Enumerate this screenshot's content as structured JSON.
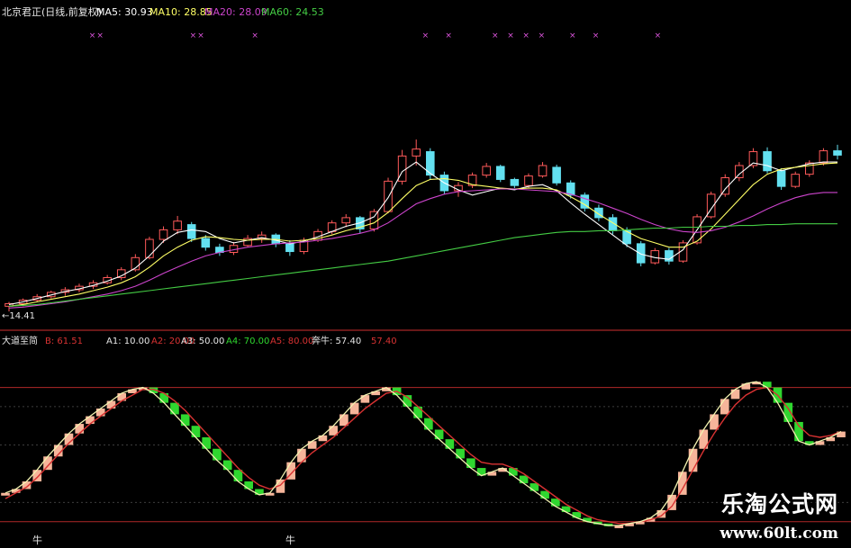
{
  "header": {
    "name": "北京君正(日线,前复权)",
    "ma5": "MA5: 30.93",
    "ma10": "MA10: 28.85",
    "ma20": "MA20: 28.09",
    "ma60": "MA60: 24.53"
  },
  "low_label": "←14.41",
  "indicator_header": {
    "name": "大道至简",
    "b": "B: 61.51",
    "a1": "A1: 10.00",
    "a2": "A2: 20.00",
    "a3": "A3: 50.00",
    "a4": "A4: 70.00",
    "a5": "A5: 80.00",
    "bull": "奔牛: 57.40",
    "last": "57.40"
  },
  "bull_markers": [
    "牛",
    "牛"
  ],
  "watermark": {
    "title": "乐淘公式网",
    "url": "www.60lt.com"
  },
  "colors": {
    "background": "#000000",
    "up_candle": "#ff5a5a",
    "down_candle": "#63e0f0",
    "ma5": "#ffffff",
    "ma10": "#ffff66",
    "ma20": "#cc44cc",
    "ma60": "#44cc44",
    "rising_bar": "#f6b59a",
    "falling_bar": "#2fd72f",
    "a_line": "#f2f2b0",
    "b_line": "#d83232",
    "level_line": "#b02828",
    "marker": "#dd55dd"
  },
  "chart_data": [
    {
      "type": "candlestick",
      "title": "北京君正(日线,前复权)",
      "ylim": [
        14,
        37
      ],
      "low_marker": 14.41,
      "series": [
        {
          "name": "MA5",
          "values": [
            15.2,
            15.5,
            15.9,
            16.3,
            16.7,
            17.0,
            17.4,
            17.9,
            18.5,
            19.4,
            20.8,
            22.5,
            23.5,
            23.8,
            23.6,
            22.8,
            22.3,
            22.6,
            22.9,
            22.6,
            22.2,
            22.5,
            23.0,
            23.6,
            24.2,
            24.6,
            25.3,
            27.5,
            30.5,
            31.6,
            30.3,
            29.2,
            28.4,
            27.8,
            28.2,
            28.6,
            28.4,
            28.8,
            29.0,
            28.3,
            26.9,
            25.6,
            24.4,
            23.2,
            22.0,
            21.0,
            20.6,
            20.4,
            21.5,
            23.8,
            26.2,
            28.5,
            30.2,
            31.5,
            31.2,
            30.6,
            31.0,
            31.4,
            31.6,
            31.6
          ]
        },
        {
          "name": "MA10",
          "values": [
            15.0,
            15.2,
            15.5,
            15.8,
            16.1,
            16.4,
            16.8,
            17.2,
            17.7,
            18.4,
            19.5,
            20.8,
            21.8,
            22.6,
            23.0,
            22.9,
            22.7,
            22.6,
            22.7,
            22.7,
            22.5,
            22.6,
            22.8,
            23.2,
            23.7,
            24.1,
            24.6,
            25.8,
            27.4,
            28.9,
            29.6,
            29.7,
            29.5,
            29.0,
            28.8,
            28.6,
            28.5,
            28.6,
            28.6,
            28.4,
            27.6,
            26.7,
            25.6,
            24.6,
            23.6,
            22.8,
            22.3,
            21.8,
            21.8,
            22.5,
            23.9,
            25.6,
            27.3,
            29.0,
            30.2,
            30.8,
            31.0,
            31.2,
            31.4,
            31.5
          ]
        },
        {
          "name": "MA20",
          "values": [
            14.8,
            14.9,
            15.1,
            15.3,
            15.5,
            15.8,
            16.1,
            16.4,
            16.8,
            17.3,
            18.0,
            18.8,
            19.5,
            20.2,
            20.8,
            21.2,
            21.5,
            21.8,
            22.0,
            22.2,
            22.3,
            22.4,
            22.6,
            22.8,
            23.1,
            23.4,
            23.8,
            24.6,
            25.7,
            26.8,
            27.4,
            27.9,
            28.2,
            28.3,
            28.4,
            28.5,
            28.5,
            28.4,
            28.3,
            28.2,
            27.9,
            27.4,
            26.9,
            26.3,
            25.7,
            25.0,
            24.4,
            23.9,
            23.6,
            23.5,
            23.7,
            24.1,
            24.7,
            25.4,
            26.2,
            26.9,
            27.5,
            27.9,
            28.1,
            28.1
          ]
        },
        {
          "name": "MA60",
          "values": [
            15.0,
            15.1,
            15.2,
            15.4,
            15.6,
            15.8,
            16.0,
            16.2,
            16.4,
            16.6,
            16.8,
            17.0,
            17.2,
            17.4,
            17.6,
            17.8,
            18.0,
            18.2,
            18.4,
            18.6,
            18.8,
            19.0,
            19.2,
            19.4,
            19.6,
            19.8,
            20.0,
            20.2,
            20.5,
            20.8,
            21.1,
            21.4,
            21.7,
            22.0,
            22.3,
            22.6,
            22.9,
            23.1,
            23.3,
            23.5,
            23.6,
            23.6,
            23.7,
            23.7,
            23.8,
            23.9,
            24.0,
            24.0,
            24.1,
            24.1,
            24.2,
            24.2,
            24.3,
            24.3,
            24.4,
            24.4,
            24.5,
            24.5,
            24.5,
            24.5
          ]
        }
      ],
      "candles": [
        {
          "o": 15.0,
          "h": 15.5,
          "l": 14.4,
          "c": 15.3
        },
        {
          "o": 15.3,
          "h": 15.9,
          "l": 15.0,
          "c": 15.7
        },
        {
          "o": 15.7,
          "h": 16.4,
          "l": 15.5,
          "c": 16.1
        },
        {
          "o": 16.1,
          "h": 16.8,
          "l": 15.9,
          "c": 16.6
        },
        {
          "o": 16.6,
          "h": 17.2,
          "l": 16.2,
          "c": 16.9
        },
        {
          "o": 16.9,
          "h": 17.6,
          "l": 16.6,
          "c": 17.3
        },
        {
          "o": 17.3,
          "h": 18.0,
          "l": 17.0,
          "c": 17.7
        },
        {
          "o": 17.7,
          "h": 18.6,
          "l": 17.5,
          "c": 18.3
        },
        {
          "o": 18.3,
          "h": 19.5,
          "l": 18.0,
          "c": 19.2
        },
        {
          "o": 19.2,
          "h": 21.0,
          "l": 19.0,
          "c": 20.6
        },
        {
          "o": 20.6,
          "h": 23.0,
          "l": 20.4,
          "c": 22.7
        },
        {
          "o": 22.7,
          "h": 24.2,
          "l": 22.3,
          "c": 23.8
        },
        {
          "o": 23.8,
          "h": 25.4,
          "l": 23.3,
          "c": 24.8
        },
        {
          "o": 24.4,
          "h": 24.7,
          "l": 22.4,
          "c": 22.8
        },
        {
          "o": 22.8,
          "h": 23.2,
          "l": 21.4,
          "c": 21.8
        },
        {
          "o": 21.8,
          "h": 22.2,
          "l": 20.8,
          "c": 21.2
        },
        {
          "o": 21.2,
          "h": 22.4,
          "l": 20.9,
          "c": 22.0
        },
        {
          "o": 22.0,
          "h": 23.2,
          "l": 21.8,
          "c": 22.8
        },
        {
          "o": 22.8,
          "h": 23.6,
          "l": 22.3,
          "c": 23.2
        },
        {
          "o": 23.2,
          "h": 23.4,
          "l": 21.8,
          "c": 22.2
        },
        {
          "o": 22.2,
          "h": 22.6,
          "l": 20.8,
          "c": 21.3
        },
        {
          "o": 21.3,
          "h": 22.9,
          "l": 21.0,
          "c": 22.6
        },
        {
          "o": 22.6,
          "h": 23.9,
          "l": 22.4,
          "c": 23.6
        },
        {
          "o": 23.6,
          "h": 24.9,
          "l": 23.3,
          "c": 24.6
        },
        {
          "o": 24.6,
          "h": 25.6,
          "l": 24.1,
          "c": 25.2
        },
        {
          "o": 25.2,
          "h": 25.4,
          "l": 23.4,
          "c": 23.9
        },
        {
          "o": 23.9,
          "h": 26.2,
          "l": 23.6,
          "c": 25.9
        },
        {
          "o": 25.9,
          "h": 29.8,
          "l": 25.7,
          "c": 29.4
        },
        {
          "o": 29.4,
          "h": 33.0,
          "l": 29.0,
          "c": 32.3
        },
        {
          "o": 32.3,
          "h": 34.2,
          "l": 31.2,
          "c": 33.1
        },
        {
          "o": 32.8,
          "h": 33.2,
          "l": 29.6,
          "c": 30.1
        },
        {
          "o": 30.1,
          "h": 30.5,
          "l": 27.9,
          "c": 28.3
        },
        {
          "o": 28.3,
          "h": 29.3,
          "l": 27.6,
          "c": 28.9
        },
        {
          "o": 28.9,
          "h": 30.4,
          "l": 28.6,
          "c": 30.1
        },
        {
          "o": 30.1,
          "h": 31.5,
          "l": 29.8,
          "c": 31.1
        },
        {
          "o": 31.1,
          "h": 31.3,
          "l": 29.3,
          "c": 29.6
        },
        {
          "o": 29.6,
          "h": 29.8,
          "l": 28.6,
          "c": 28.9
        },
        {
          "o": 28.9,
          "h": 30.3,
          "l": 28.6,
          "c": 30.0
        },
        {
          "o": 30.0,
          "h": 31.6,
          "l": 29.8,
          "c": 31.2
        },
        {
          "o": 31.0,
          "h": 31.3,
          "l": 28.9,
          "c": 29.2
        },
        {
          "o": 29.2,
          "h": 29.5,
          "l": 27.4,
          "c": 27.8
        },
        {
          "o": 27.8,
          "h": 28.1,
          "l": 25.9,
          "c": 26.3
        },
        {
          "o": 26.3,
          "h": 26.7,
          "l": 24.8,
          "c": 25.2
        },
        {
          "o": 25.2,
          "h": 25.6,
          "l": 23.3,
          "c": 23.7
        },
        {
          "o": 23.7,
          "h": 24.1,
          "l": 21.8,
          "c": 22.2
        },
        {
          "o": 22.2,
          "h": 22.5,
          "l": 19.6,
          "c": 20.0
        },
        {
          "o": 20.0,
          "h": 21.7,
          "l": 19.8,
          "c": 21.4
        },
        {
          "o": 21.4,
          "h": 21.7,
          "l": 19.8,
          "c": 20.2
        },
        {
          "o": 20.2,
          "h": 22.6,
          "l": 20.0,
          "c": 22.3
        },
        {
          "o": 22.3,
          "h": 25.6,
          "l": 22.1,
          "c": 25.3
        },
        {
          "o": 25.3,
          "h": 28.2,
          "l": 25.1,
          "c": 27.9
        },
        {
          "o": 27.9,
          "h": 30.2,
          "l": 27.6,
          "c": 29.8
        },
        {
          "o": 29.8,
          "h": 31.6,
          "l": 29.4,
          "c": 31.2
        },
        {
          "o": 31.2,
          "h": 33.2,
          "l": 30.9,
          "c": 32.8
        },
        {
          "o": 32.8,
          "h": 33.3,
          "l": 30.3,
          "c": 30.6
        },
        {
          "o": 30.6,
          "h": 30.9,
          "l": 28.4,
          "c": 28.8
        },
        {
          "o": 28.8,
          "h": 30.5,
          "l": 28.6,
          "c": 30.2
        },
        {
          "o": 30.2,
          "h": 31.8,
          "l": 29.9,
          "c": 31.5
        },
        {
          "o": 31.5,
          "h": 33.2,
          "l": 31.2,
          "c": 32.9
        },
        {
          "o": 32.9,
          "h": 33.6,
          "l": 31.9,
          "c": 32.4
        }
      ]
    },
    {
      "type": "bar",
      "title": "大道至简",
      "ylim": [
        0,
        100
      ],
      "levels": [
        10,
        20,
        50,
        70,
        80
      ],
      "series": [
        {
          "name": "A",
          "values": [
            25,
            27,
            31,
            37,
            44,
            50,
            56,
            61,
            65,
            69,
            73,
            77,
            79,
            80,
            77,
            72,
            66,
            60,
            54,
            48,
            42,
            37,
            31,
            27,
            24,
            25,
            32,
            41,
            48,
            52,
            55,
            60,
            66,
            72,
            76,
            78,
            80,
            76,
            70,
            64,
            58,
            53,
            48,
            43,
            38,
            34,
            36,
            38,
            34,
            30,
            26,
            22,
            18,
            15,
            12,
            10,
            9,
            8,
            8,
            9,
            10,
            12,
            16,
            24,
            36,
            48,
            58,
            66,
            74,
            79,
            82,
            83,
            80,
            72,
            62,
            52,
            50,
            52,
            54,
            57
          ]
        },
        {
          "name": "B",
          "values": [
            22,
            25,
            28,
            33,
            39,
            45,
            51,
            56,
            61,
            65,
            69,
            73,
            76,
            79,
            79,
            77,
            73,
            68,
            62,
            56,
            50,
            44,
            38,
            33,
            29,
            27,
            29,
            35,
            41,
            46,
            50,
            54,
            59,
            64,
            69,
            73,
            77,
            78,
            75,
            70,
            65,
            60,
            55,
            50,
            45,
            41,
            40,
            40,
            38,
            35,
            31,
            27,
            23,
            19,
            16,
            13,
            11,
            10,
            9,
            9,
            10,
            11,
            13,
            18,
            27,
            37,
            47,
            56,
            64,
            71,
            76,
            79,
            80,
            76,
            69,
            60,
            55,
            54,
            55,
            57
          ]
        }
      ]
    }
  ]
}
